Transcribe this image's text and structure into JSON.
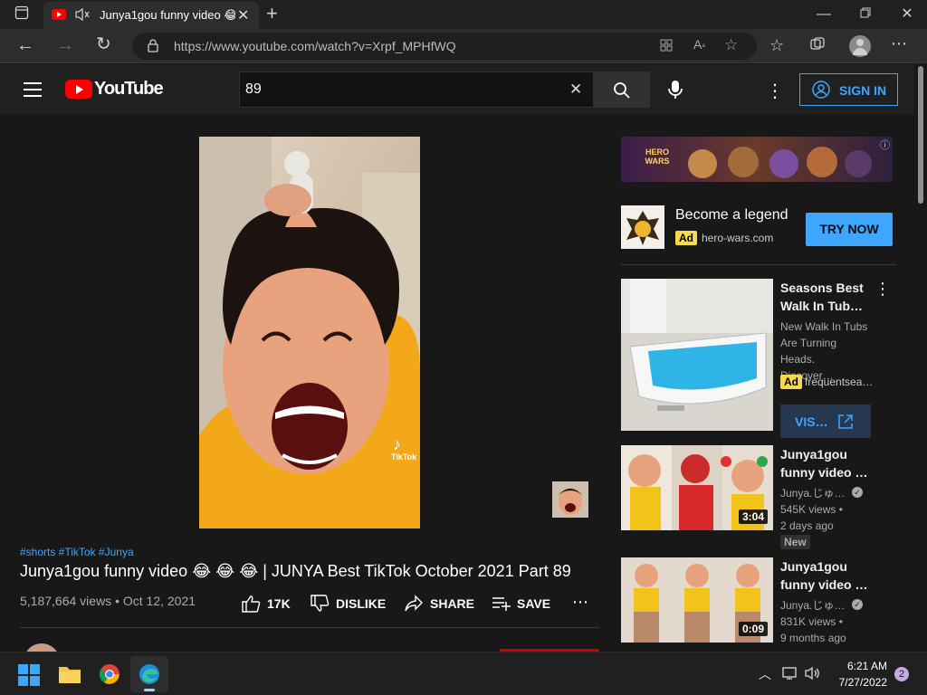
{
  "browser": {
    "tab_title": "Junya1gou funny video 😂 😂",
    "url": "https://www.youtube.com/watch?v=Xrpf_MPHfWQ"
  },
  "youtube": {
    "logo_text": "YouTube",
    "search_value": "89",
    "sign_in": "SIGN IN"
  },
  "video": {
    "hashtags": "#shorts #TikTok #Junya",
    "title": "Junya1gou funny video 😂 😂 😂 | JUNYA Best TikTok October 2021 Part 89",
    "meta": "5,187,664 views • Oct 12, 2021",
    "like_count": "17K",
    "dislike": "DISLIKE",
    "share": "SHARE",
    "save": "SAVE",
    "tiktok_watermark": "TikTok"
  },
  "ad": {
    "banner_text": "HERO WARS",
    "headline": "Become a legend",
    "badge": "Ad",
    "domain": "hero-wars.com",
    "cta": "TRY NOW"
  },
  "sidebar": [
    {
      "title": "Seasons Best Walk In Tub…",
      "desc": "New Walk In Tubs Are Turning Heads. Discover…",
      "badge": "Ad",
      "channel": "frequentsea…",
      "cta": "VIS…"
    },
    {
      "title": "Junya1gou funny video …",
      "channel": "Junya.じゅ…",
      "views": "545K views •",
      "age": "2 days ago",
      "badge": "New",
      "duration": "3:04"
    },
    {
      "title": "Junya1gou funny video …",
      "channel": "Junya.じゅ…",
      "views": "831K views •",
      "age": "9 months ago",
      "duration": "0:09"
    }
  ],
  "taskbar": {
    "time": "6:21 AM",
    "date": "7/27/2022",
    "notification_count": "2"
  },
  "colors": {
    "youtube_red": "#ff0000",
    "link_blue": "#3ea6ff",
    "ad_yellow": "#f9d94c"
  }
}
